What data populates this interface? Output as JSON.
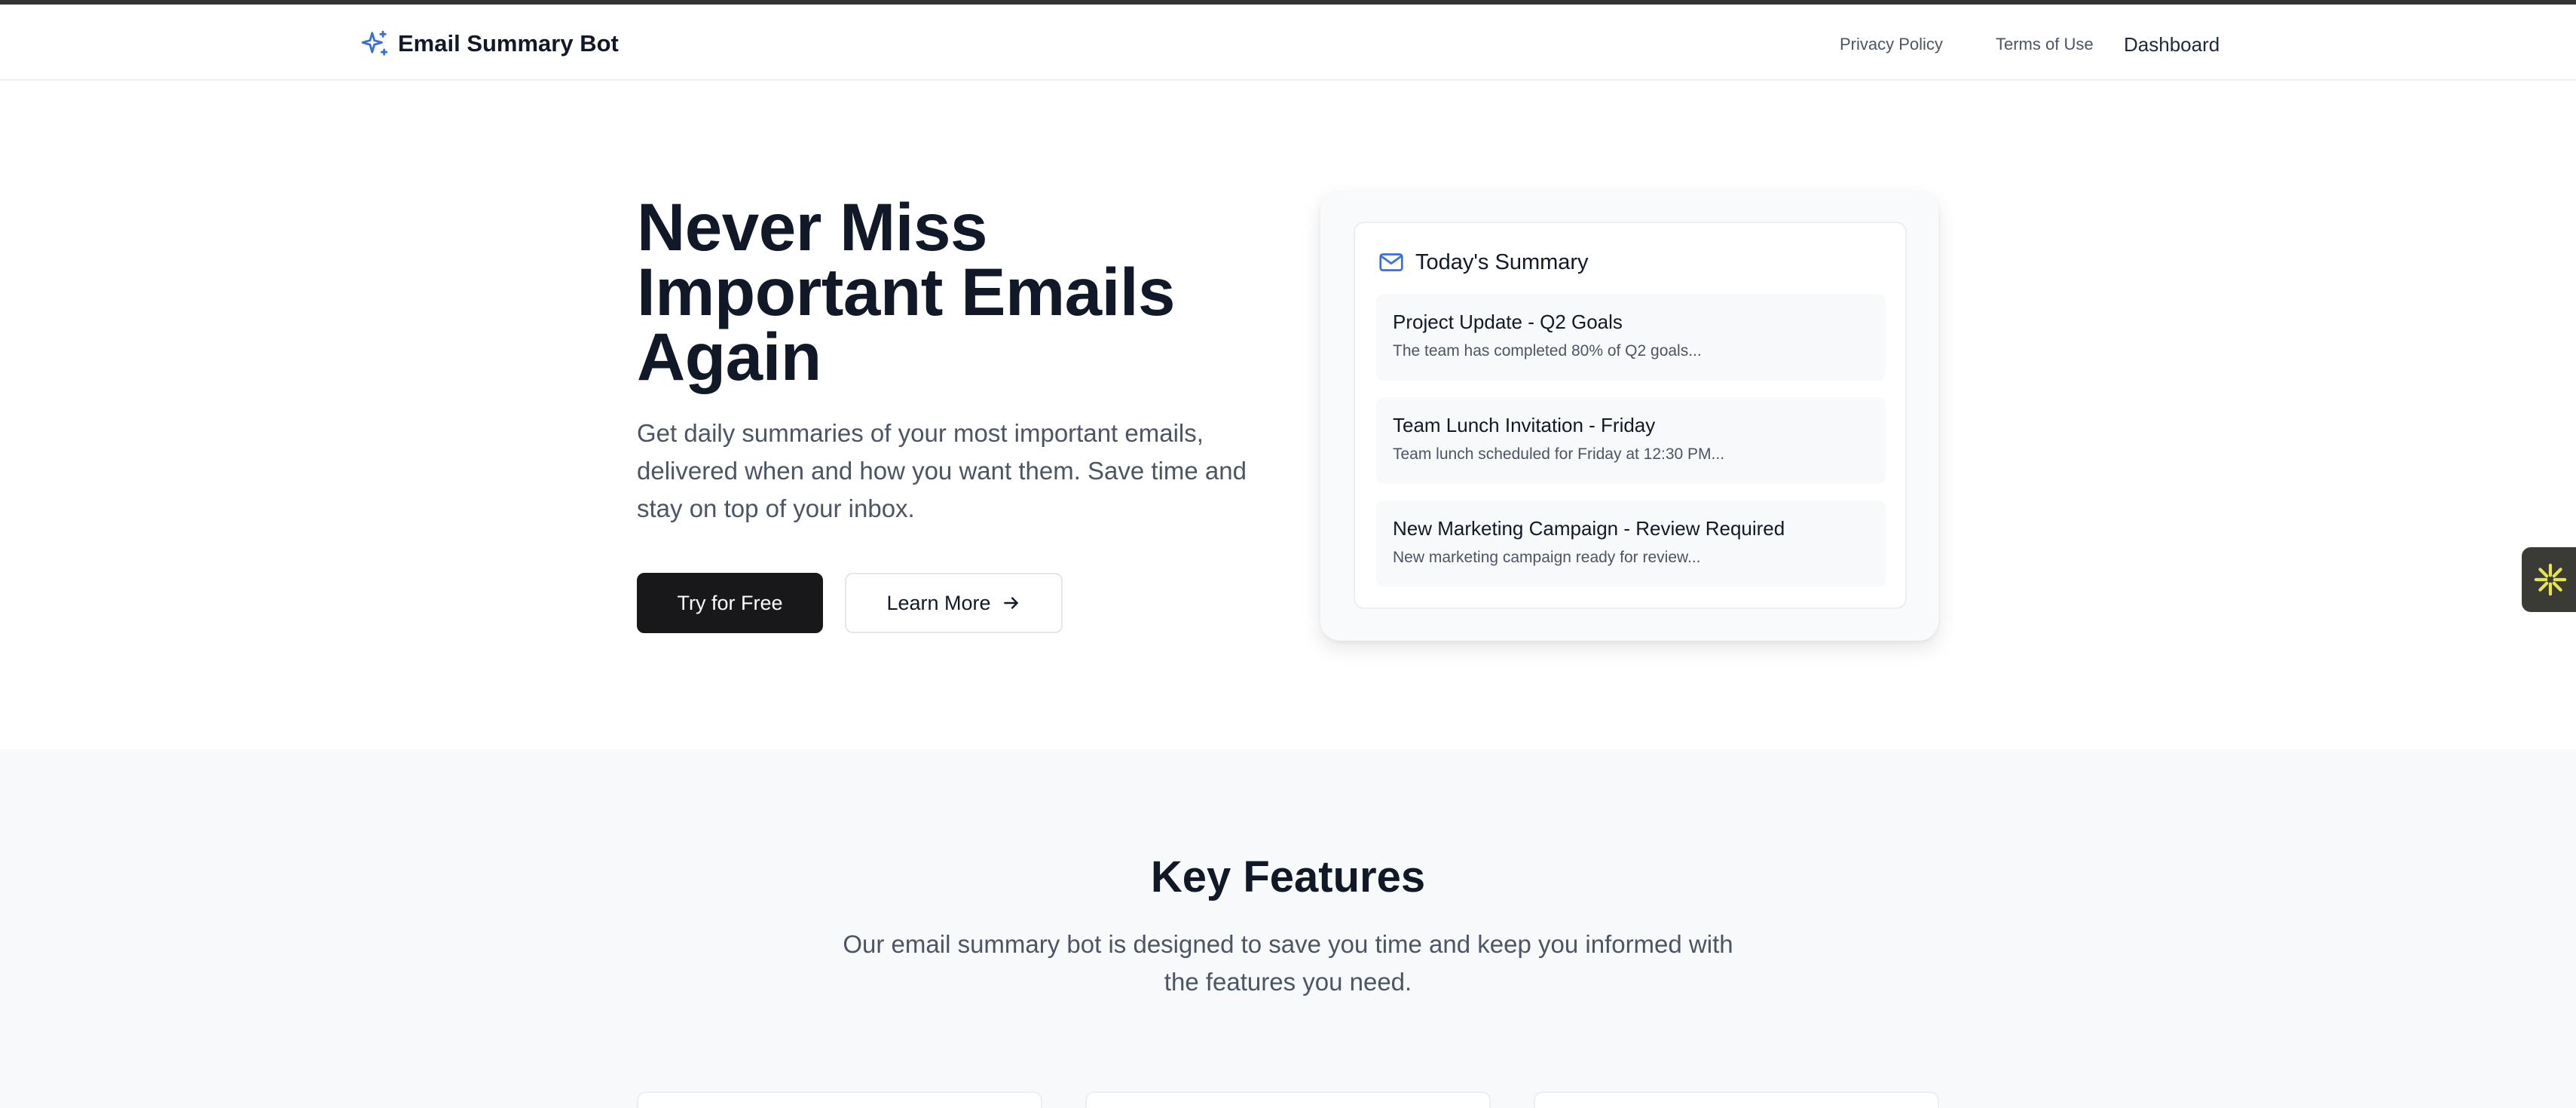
{
  "nav": {
    "brand": "Email Summary Bot",
    "brand_icon": "sparkles-icon",
    "privacy": "Privacy Policy",
    "terms": "Terms of Use",
    "dashboard": "Dashboard"
  },
  "hero": {
    "title": "Never Miss Important Emails Again",
    "subtitle": "Get daily summaries of your most important emails, delivered when and how you want them. Save time and stay on top of your inbox.",
    "primary_button": "Try for Free",
    "secondary_button": "Learn More",
    "secondary_icon": "arrow-right-icon"
  },
  "summary_card": {
    "title": "Today's Summary",
    "icon": "mail-icon",
    "emails": [
      {
        "subject": "Project Update - Q2 Goals",
        "preview": "The team has completed 80% of Q2 goals..."
      },
      {
        "subject": "Team Lunch Invitation - Friday",
        "preview": "Team lunch scheduled for Friday at 12:30 PM..."
      },
      {
        "subject": "New Marketing Campaign - Review Required",
        "preview": "New marketing campaign ready for review..."
      }
    ]
  },
  "features": {
    "title": "Key Features",
    "subtitle": "Our email summary bot is designed to save you time and keep you informed with the features you need."
  },
  "colors": {
    "accent": "#3b6fd8",
    "primary_button": "#18181b",
    "widget_bg": "#3a3a36",
    "widget_icon": "#e8e54a"
  }
}
